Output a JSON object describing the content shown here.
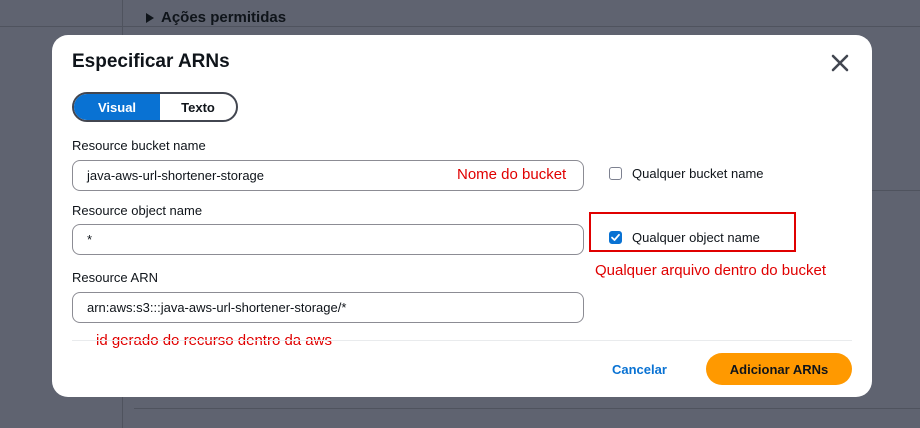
{
  "background": {
    "section_title": "Ações permitidas"
  },
  "modal": {
    "title": "Especificar ARNs",
    "close_icon": "close-icon",
    "tabs": [
      {
        "label": "Visual",
        "active": true
      },
      {
        "label": "Texto",
        "active": false
      }
    ],
    "fields": {
      "bucket": {
        "label": "Resource bucket name",
        "value": "java-aws-url-shortener-storage"
      },
      "object": {
        "label": "Resource object name",
        "value": "*"
      },
      "arn": {
        "label": "Resource ARN",
        "value": "arn:aws:s3:::java-aws-url-shortener-storage/*"
      }
    },
    "checkboxes": {
      "any_bucket": {
        "label": "Qualquer bucket name",
        "checked": false
      },
      "any_object": {
        "label": "Qualquer object name",
        "checked": true
      }
    },
    "footer": {
      "cancel_label": "Cancelar",
      "submit_label": "Adicionar ARNs"
    }
  },
  "annotations": {
    "bucket_note": "Nome do bucket",
    "object_note": "Qualquer arquivo dentro do bucket",
    "arn_note": "id gerado do recurso dentro da aws"
  },
  "colors": {
    "accent": "#0972d3",
    "primary_button": "#ff9900",
    "annotation": "#e00000",
    "overlay": "#5f6370"
  }
}
